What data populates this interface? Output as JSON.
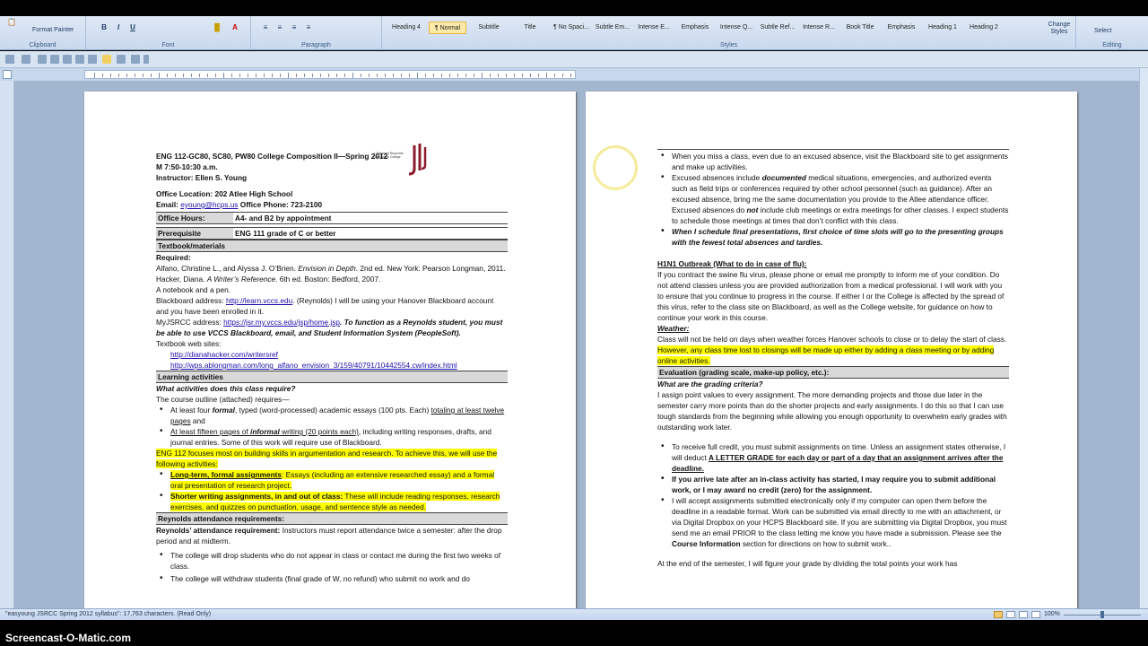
{
  "ribbon": {
    "clipboard": {
      "format_painter": "Format Painter",
      "label": "Clipboard",
      "paste_icon": "paste-icon"
    },
    "font": {
      "label": "Font",
      "bold": "B",
      "italic": "I",
      "underline": "U"
    },
    "paragraph": {
      "label": "Paragraph"
    },
    "styles": {
      "label": "Styles",
      "items": [
        "Heading 4",
        "¶ Normal",
        "Subtitle",
        "Title",
        "¶ No Spaci...",
        "Subtle Em...",
        "Intense E...",
        "Emphasis",
        "Intense Q...",
        "Subtle Ref...",
        "Intense R...",
        "Book Title",
        "Emphasis",
        "Heading 1",
        "Heading 2"
      ],
      "change_styles": "Change Styles"
    },
    "editing": {
      "label": "Editing",
      "select": "Select"
    }
  },
  "page1": {
    "header_line1": "ENG 112-GC80, SC80, PW80 College Composition II—Spring 2012",
    "header_line2": "M 7:50-10:30  a.m.",
    "header_line3": "Instructor: Ellen S. Young",
    "office_location": "Office Location: 202  Atlee High School",
    "email_label": "Email: ",
    "email": "eyoung@hcps.us",
    "phone": " Office Phone: 723-2100",
    "logo_text": "J. Sargeant Reynolds Community College",
    "office_hours_label": "Office Hours:",
    "office_hours_value": "A4- and B2 by appointment",
    "prereq_label": "Prerequisite",
    "prereq_value": "ENG 111 grade of C or better",
    "textbook_header": "Textbook/materials",
    "required": "Required:",
    "book1_a": "Alfano, Christine L., and Alyssa J. O’Brien. ",
    "book1_title": "Envision in Depth",
    "book1_b": ". 2nd ed. New York: Pearson Longman, 2011.",
    "book2_a": "Hacker, Diana. ",
    "book2_title": "A Writer’s Reference",
    "book2_b": ". 6th ed. Boston: Bedford, 2007.",
    "notebook": "A notebook and a pen.",
    "bb_label": "Blackboard address: ",
    "bb_link": "http://learn.vccs.edu",
    "bb_rest": ". (Reynolds) I will be using your Hanover Blackboard account and you have been enrolled in it.",
    "my_label": "MyJSRCC address: ",
    "my_link": "https://jsr.my.vccs.edu/jsp/home.jsp",
    "my_rest": ". To function as a Reynolds student, you must be able to use VCCS Blackboard, email, and Student Information System (PeopleSoft).",
    "web_label": "Textbook web sites:",
    "web1": "http://dianahacker.com/writersref",
    "web2": "http://wps.ablongman.com/long_alfano_envision_3/159/40791/10442554.cw/index.html",
    "learning_header": "Learning activities",
    "learning_q": "What activities does this class require?",
    "outline": "The course outline (attached) requires—",
    "act1_a": "At least four ",
    "act1_b": "formal",
    "act1_c": ", typed (word-processed) academic essays (100 pts. Each) ",
    "act1_d": "totaling at least twelve pages",
    "act1_e": " and",
    "act2_a": "At least fifteen pages of ",
    "act2_b": "informal",
    "act2_c": " writing (20 points each)",
    "act2_d": ", including writing responses, drafts, and journal entries. Some of this work will require use of Blackboard.",
    "focus": "ENG 112 focuses most on building skills in argumentation and research. To achieve this, we will use the following activities:",
    "lt_a": "Long-term, formal assignments",
    "lt_b": ": Essays (including an extensive researched essay) and a formal oral presentation of research project.",
    "sw_a": "Shorter writing assignments, in and out of class:",
    "sw_b": " These will include reading responses, research exercises, and quizzes on punctuation, usage, and sentence style as needed.",
    "att_header": "Reynolds attendance requirements:",
    "att_a": "Reynolds’ attendance requirement:",
    "att_b": " Instructors must report attendance twice a semester: after the drop period and at midterm.",
    "drop1": "The college will drop students who do not appear in class or contact me during the first two weeks of class.",
    "drop2": "The college will withdraw students (final grade of W, no refund) who submit no work and do"
  },
  "page2": {
    "abs1": "When you miss a class, even due to an excused absence, visit the Blackboard site to get assignments and make up activities.",
    "abs2_a": "Excused absences include ",
    "abs2_b": "documented",
    "abs2_c": " medical situations, emergencies, and authorized events such as field trips or conferences required by other school personnel (such as guidance). After an excused absence, bring me the same documentation you provide to the Atlee attendance officer. Excused absences do ",
    "abs2_d": "not",
    "abs2_e": " include club meetings or extra meetings for other classes. I expect students to schedule those meetings at times that don’t conflict with this class.",
    "abs3": "When I schedule final presentations, first choice of time slots will go to the presenting groups with the fewest total absences and tardies.",
    "h1n1_header": "H1N1 Outbreak (What to do in case of flu):",
    "h1n1": "If you contract the swine flu virus, please phone or email me promptly to inform me of your condition. Do not attend classes unless you are provided authorization from a medical professional.  I will work with you to ensure that you continue to progress in the course.  If either I or the College is affected by the spread of this virus, refer to the class site on Blackboard, as well as the College website, for guidance on how to continue your work in this course.",
    "weather_header": "Weather:",
    "weather_a": "Class will not be held on days when weather forces Hanover schools to close or to delay the start of class. ",
    "weather_b": "However, any class time lost to closings will be made up either by adding a class meeting or by adding online activities.",
    "eval_header": "Evaluation (grading scale, make-up policy, etc.):",
    "eval_q": "What are the grading criteria?",
    "eval_text": "I assign point values to every assignment.  The more demanding projects and those due later in the semester carry more points than do the shorter projects and early assignments.  I do this so that I can use tough standards from the beginning while allowing you enough opportunity to overwhelm early grades with outstanding work later.",
    "g1_a": "To receive full credit, you must submit assignments on time.  Unless an assignment states otherwise, I will deduct ",
    "g1_b": "A LETTER GRADE for each day or part of a day that an assignment arrives after the deadline.",
    "g2": "If you arrive late after an in-class activity has started, I may require you to submit additional work, or I may award no credit (zero) for the assignment.",
    "g3_a": "I will accept assignments submitted electronically only if my computer can open them before the deadline in a readable format. Work can be submitted via email directly to me with an attachment, or via Digital Dropbox on your HCPS Blackboard site.  If you are submitting via Digital Dropbox,  you must send me an email PRIOR to the class letting me know you have made a submission. Please see the ",
    "g3_b": "Course Information",
    "g3_c": " section for directions on how to submit work..",
    "end_sem": "At the end of the semester, I will figure your grade by dividing the total points your work has"
  },
  "status": {
    "doc": "\"easyoung JSRCC Spring 2012 syllabus\": 17,763 characters.  (Read Only)",
    "zoom": "100%"
  },
  "watermark": "Screencast-O-Matic.com"
}
